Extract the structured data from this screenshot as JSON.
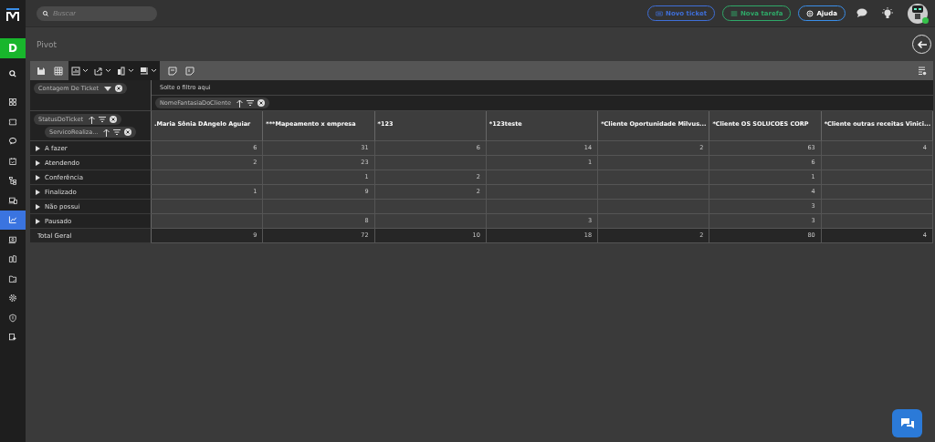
{
  "sidebar": {
    "workspace_letter": "D",
    "items": [
      {
        "kind": "search",
        "selected": false
      },
      {
        "kind": "grid",
        "selected": false
      },
      {
        "kind": "ticket",
        "selected": false
      },
      {
        "kind": "chat",
        "selected": false
      },
      {
        "kind": "calendar",
        "selected": false
      },
      {
        "kind": "tree",
        "selected": false
      },
      {
        "kind": "devices",
        "selected": false
      },
      {
        "kind": "chart",
        "selected": true
      },
      {
        "kind": "money",
        "selected": false
      },
      {
        "kind": "book",
        "selected": false
      },
      {
        "kind": "folder",
        "selected": false
      },
      {
        "kind": "gear",
        "selected": false
      },
      {
        "kind": "shield",
        "selected": false
      },
      {
        "kind": "logout",
        "selected": false
      }
    ]
  },
  "topbar": {
    "search": {
      "placeholder": "Buscar"
    },
    "buttons": [
      {
        "kind": "ticket",
        "label": "Novo ticket",
        "color": "#3f6fd8"
      },
      {
        "kind": "task",
        "label": "Nova tarefa",
        "color": "#2fa868"
      },
      {
        "kind": "help",
        "label": "Ajuda",
        "color": "#3a8ee8"
      }
    ],
    "user_online": true
  },
  "page": {
    "title": "Pivot"
  },
  "pivot": {
    "value_field": "Contagem De Ticket",
    "filter_placeholder": "Solte o filtro aqui",
    "column_field": "NomeFantasiaDoCliente",
    "row_fields": [
      "StatusDoTicket",
      "ServicoRealiza..."
    ],
    "columns": [
      ".Maria Sônia DAngelo Aguiar",
      "***Mapeamento x empresa",
      "*123",
      "*123teste",
      "*Cliente Oportunidade Milvus...",
      "*Cliente OS SOLUCOES CORP",
      "*Cliente outras receitas Vinici..."
    ],
    "rows": [
      {
        "label": "A fazer",
        "values": {
          "column_1": "6",
          "column_2": "31",
          "column_3": "6",
          "column_4": "14",
          "column_5": "2",
          "column_6": "63",
          "column_7": "4"
        }
      },
      {
        "label": "Atendendo",
        "values": {
          "column_1": "2",
          "column_2": "23",
          "column_4": "1",
          "column_6": "6"
        }
      },
      {
        "label": "Conferência",
        "values": {
          "column_2": "1",
          "column_3": "2",
          "column_6": "1"
        }
      },
      {
        "label": "Finalizado",
        "values": {
          "column_1": "1",
          "column_2": "9",
          "column_3": "2",
          "column_6": "4"
        }
      },
      {
        "label": "Não possui",
        "values": {
          "column_6": "3"
        }
      },
      {
        "label": "Pausado",
        "values": {
          "column_2": "8",
          "column_4": "3",
          "column_6": "3"
        }
      }
    ],
    "total": {
      "label": "Total Geral",
      "values": [
        "9",
        "72",
        "10",
        "18",
        "2",
        "80",
        "4"
      ]
    }
  }
}
